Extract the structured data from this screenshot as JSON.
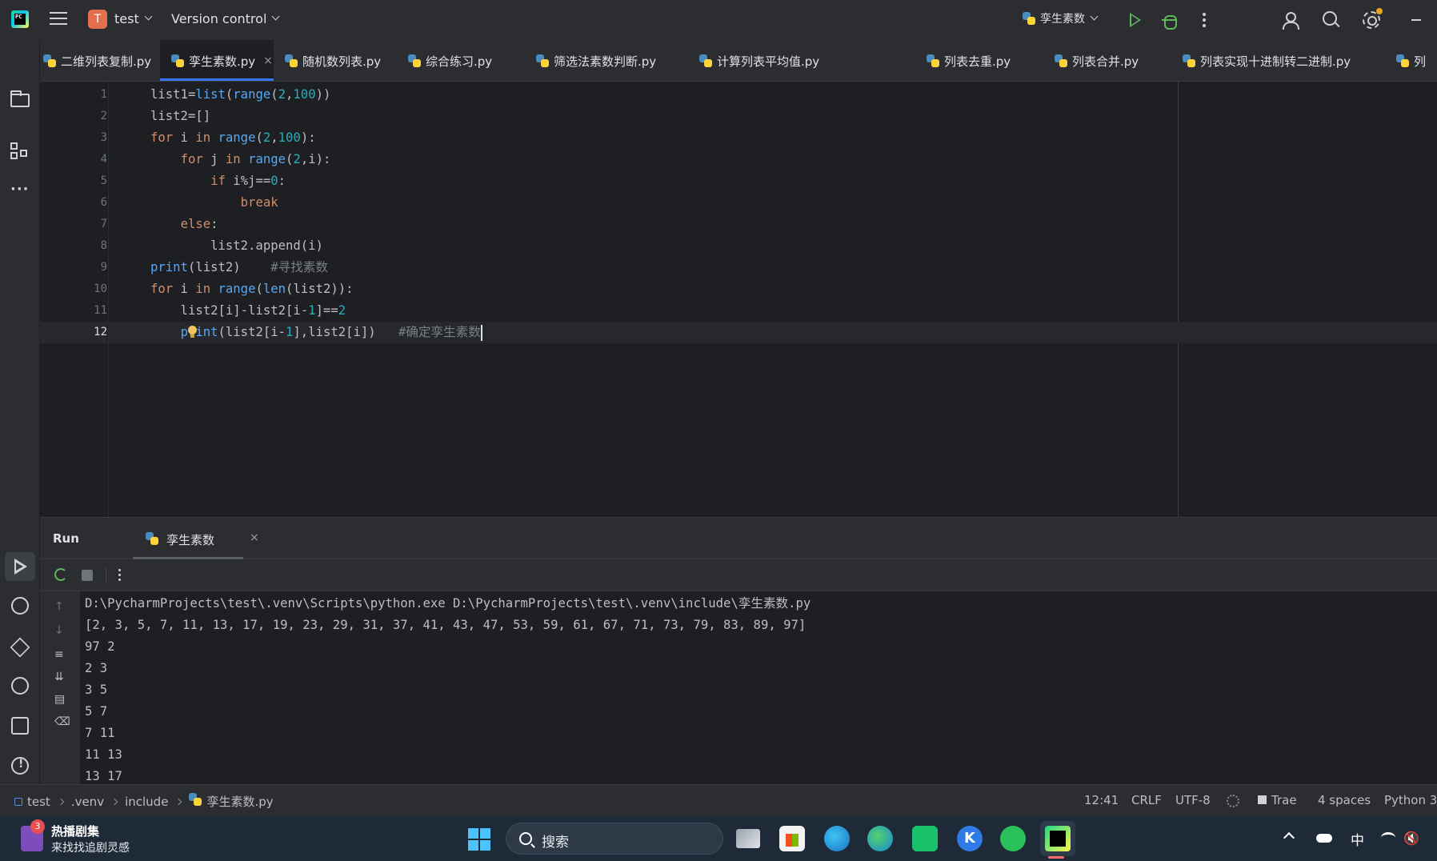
{
  "titlebar": {
    "logo": "PC",
    "project_initial": "T",
    "project_name": "test",
    "vcs_menu": "Version control",
    "run_config": "孪生素数",
    "accent_run_color": "#5fb85f"
  },
  "tabs": [
    {
      "label": "二维列表复制.py",
      "active": false
    },
    {
      "label": "孪生素数.py",
      "active": true
    },
    {
      "label": "随机数列表.py",
      "active": false
    },
    {
      "label": "综合练习.py",
      "active": false
    },
    {
      "label": "筛选法素数判断.py",
      "active": false
    },
    {
      "label": "计算列表平均值.py",
      "active": false
    },
    {
      "label": "列表去重.py",
      "active": false
    },
    {
      "label": "列表合并.py",
      "active": false
    },
    {
      "label": "列表实现十进制转二进制.py",
      "active": false
    },
    {
      "label": "列",
      "active": false
    }
  ],
  "tab_close_glyph": "×",
  "editor": {
    "line_numbers": [
      "1",
      "2",
      "3",
      "4",
      "5",
      "6",
      "7",
      "8",
      "9",
      "10",
      "11",
      "12"
    ],
    "current_line": "12",
    "lines": [
      "list1=list(range(2,100))",
      "list2=[]",
      "for i in range(2,100):",
      "    for j in range(2,i):",
      "        if i%j==0:",
      "            break",
      "    else:",
      "        list2.append(i)",
      "print(list2)    #寻找素数",
      "for i in range(len(list2)):",
      "    list2[i]-list2[i-1]==2",
      "    print(list2[i-1],list2[i])   #确定孪生素数"
    ]
  },
  "run_panel": {
    "title": "Run",
    "tab_label": "孪生素数",
    "console": [
      "D:\\PycharmProjects\\test\\.venv\\Scripts\\python.exe D:\\PycharmProjects\\test\\.venv\\include\\孪生素数.py",
      "[2, 3, 5, 7, 11, 13, 17, 19, 23, 29, 31, 37, 41, 43, 47, 53, 59, 61, 67, 71, 73, 79, 83, 89, 97]",
      "97 2",
      "2 3",
      "3 5",
      "5 7",
      "7 11",
      "11 13",
      "13 17"
    ]
  },
  "statusbar": {
    "breadcrumb": [
      "test",
      ".venv",
      "include",
      "孪生素数.py"
    ],
    "position": "12:41",
    "line_sep": "CRLF",
    "encoding": "UTF-8",
    "plugin": "Trae",
    "indent": "4 spaces",
    "interpreter": "Python 3"
  },
  "taskbar": {
    "news_badge": "3",
    "news_title": "热播剧集",
    "news_sub": "来找找追剧灵感",
    "search_label": "搜索",
    "k_app": "K",
    "ime": "中",
    "volume": "🔇"
  }
}
